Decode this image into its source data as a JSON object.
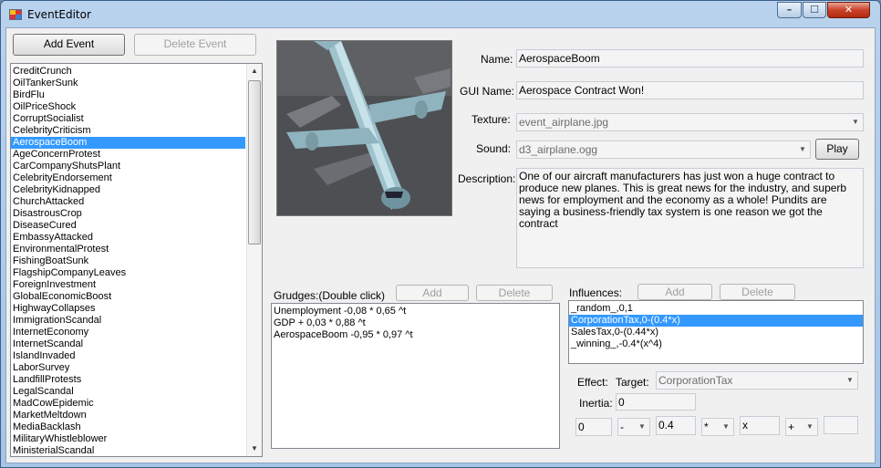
{
  "window": {
    "title": "EventEditor"
  },
  "controls": {
    "minimize": "–",
    "maximize": "☐",
    "close": "✕"
  },
  "left": {
    "add_event": "Add Event",
    "delete_event": "Delete Event",
    "events": [
      "CreditCrunch",
      "OilTankerSunk",
      "BirdFlu",
      "OilPriceShock",
      "CorruptSocialist",
      "CelebrityCriticism",
      "AerospaceBoom",
      "AgeConcernProtest",
      "CarCompanyShutsPlant",
      "CelebrityEndorsement",
      "CelebrityKidnapped",
      "ChurchAttacked",
      "DisastrousCrop",
      "DiseaseCured",
      "EmbassyAttacked",
      "EnvironmentalProtest",
      "FishingBoatSunk",
      "FlagshipCompanyLeaves",
      "ForeignInvestment",
      "GlobalEconomicBoost",
      "HighwayCollapses",
      "ImmigrationScandal",
      "InternetEconomy",
      "InternetScandal",
      "IslandInvaded",
      "LaborSurvey",
      "LandfillProtests",
      "LegalScandal",
      "MadCowEpidemic",
      "MarketMeltdown",
      "MediaBacklash",
      "MilitaryWhistleblower",
      "MinisterialScandal"
    ],
    "selected": "AerospaceBoom"
  },
  "details": {
    "name_label": "Name:",
    "name": "AerospaceBoom",
    "gui_label": "GUI Name:",
    "gui": "Aerospace Contract Won!",
    "texture_label": "Texture:",
    "texture": "event_airplane.jpg",
    "sound_label": "Sound:",
    "sound": "d3_airplane.ogg",
    "play": "Play",
    "desc_label": "Description:",
    "description": "One of our aircraft manufacturers has just won a huge contract to produce new planes. This is great news for the industry, and superb news for employment and the economy as a whole! Pundits are saying a business-friendly tax system is one reason we got the contract"
  },
  "grudges": {
    "label": "Grudges:(Double click)",
    "add": "Add",
    "delete": "Delete",
    "items": [
      "Unemployment -0,08 * 0,65 ^t",
      "GDP + 0,03 * 0,88 ^t",
      "AerospaceBoom -0,95 * 0,97 ^t"
    ]
  },
  "influences": {
    "label": "Influences:",
    "add": "Add",
    "delete": "Delete",
    "items": [
      "_random_,0,1",
      "CorporationTax,0-(0.4*x)",
      "SalesTax,0-(0.44*x)",
      "_winning_,-0.4*(x^4)"
    ],
    "selected": "CorporationTax,0-(0.4*x)"
  },
  "effect": {
    "effect_label": "Effect:",
    "target_label": "Target:",
    "target": "CorporationTax",
    "inertia_label": "Inertia:",
    "inertia": "0",
    "f0": "0",
    "op1": "-",
    "f1": "0.4",
    "op2": "*",
    "f2": "x",
    "op3": "+",
    "f3": ""
  }
}
